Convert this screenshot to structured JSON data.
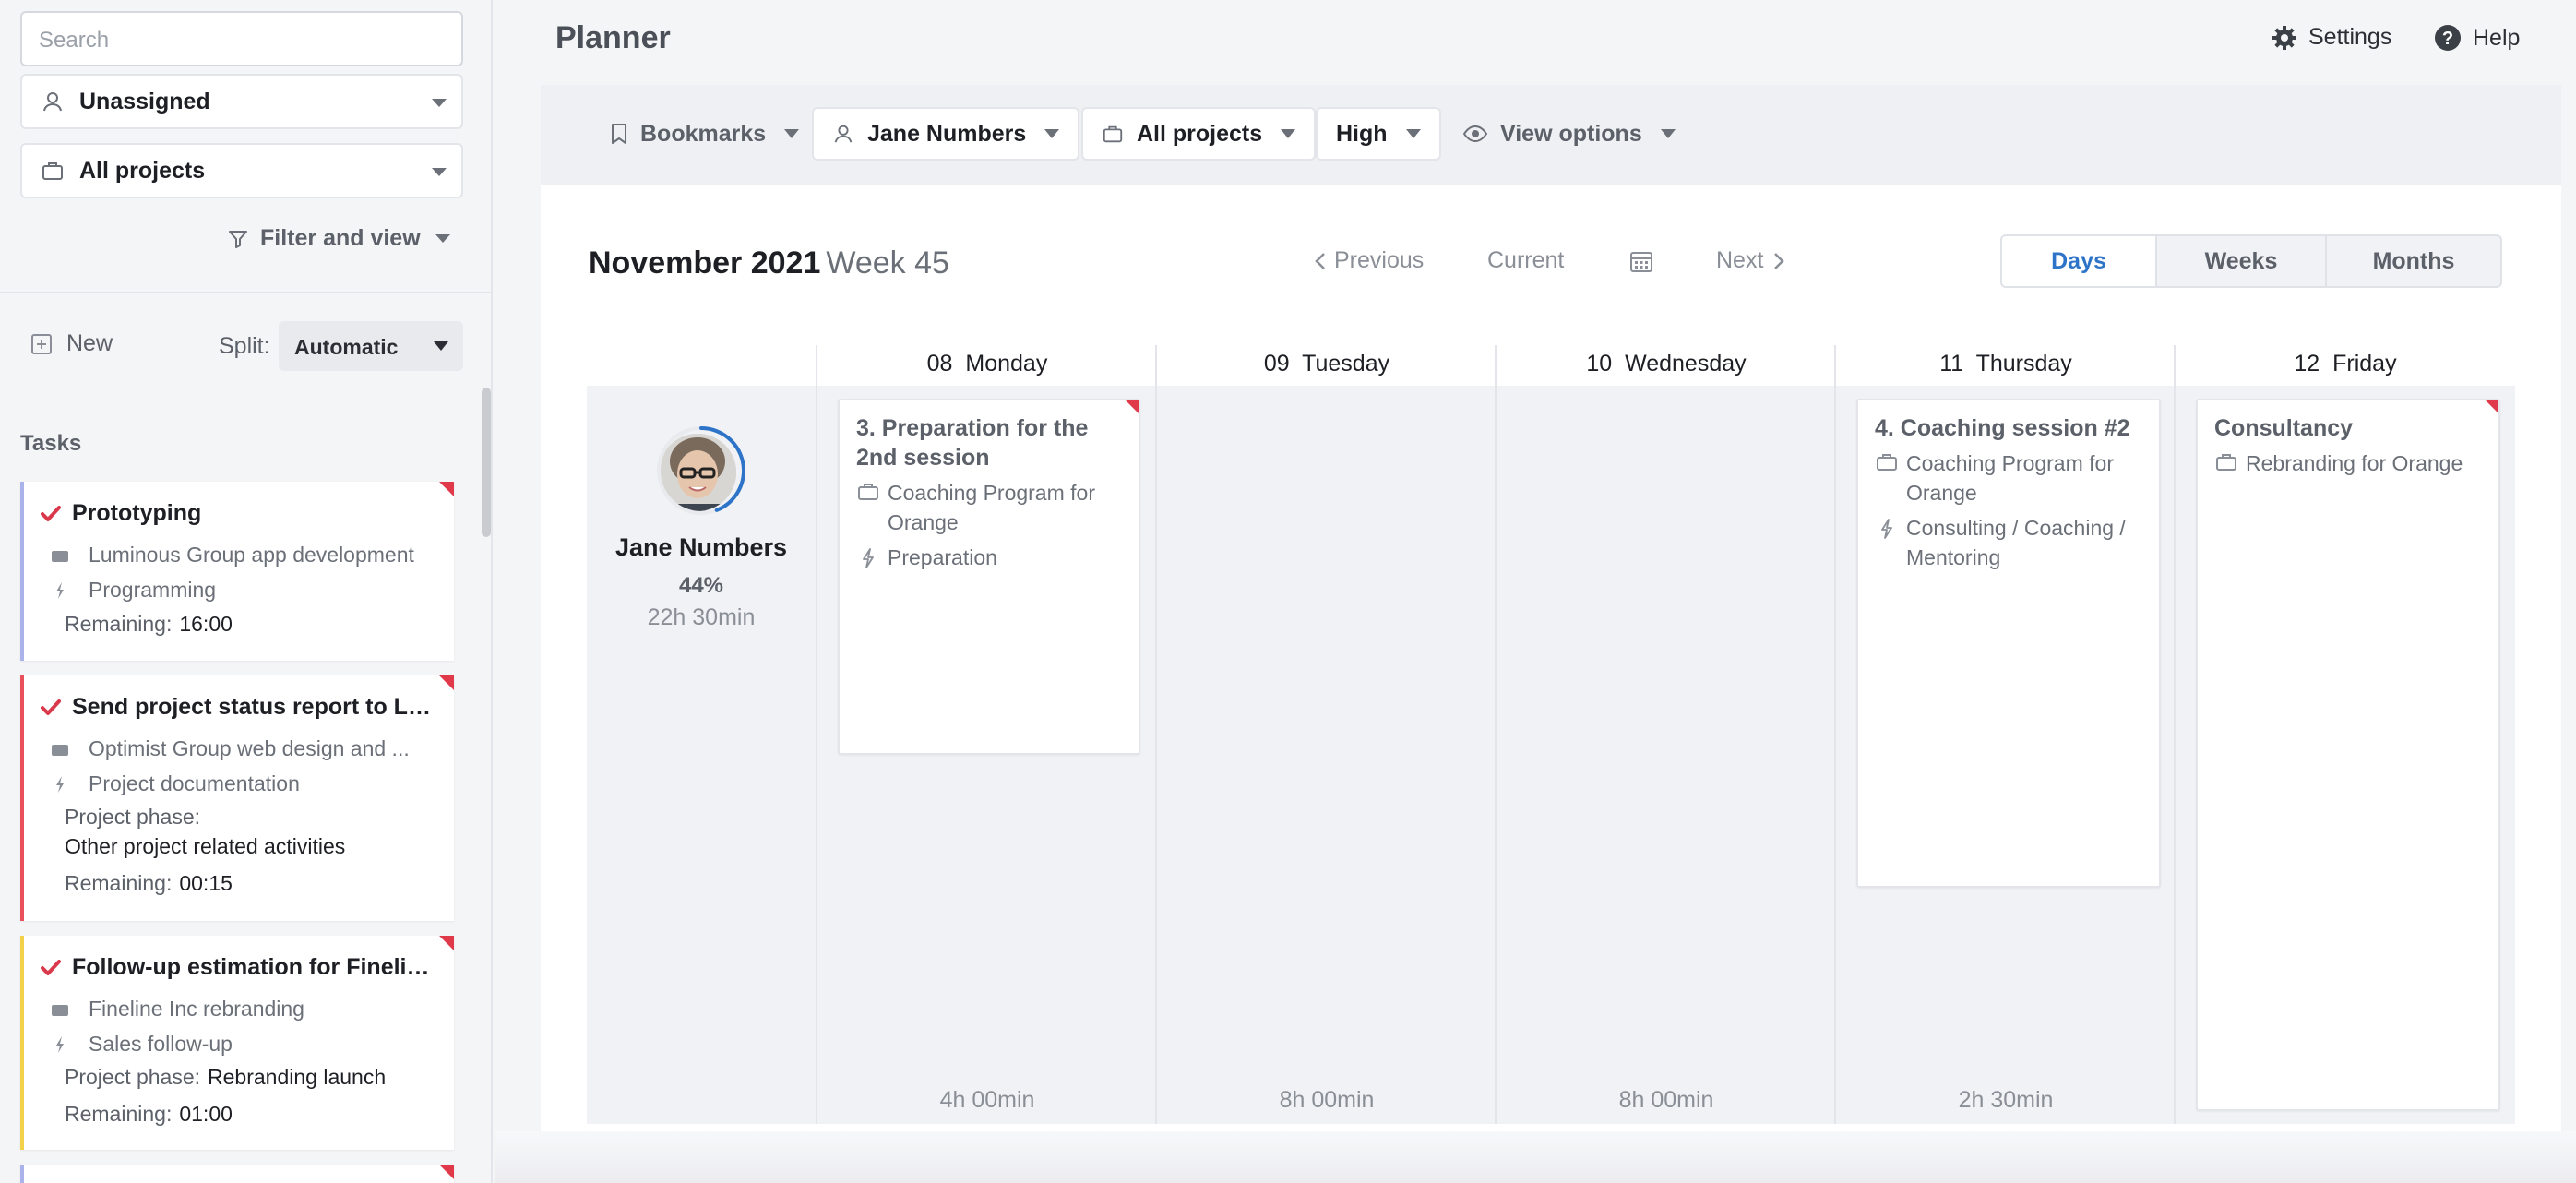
{
  "sidebar": {
    "search_placeholder": "Search",
    "user_select": "Unassigned",
    "project_select": "All projects",
    "filter_label": "Filter and view",
    "new_label": "New",
    "split_label": "Split:",
    "split_value": "Automatic",
    "tasks_heading": "Tasks",
    "tasks": [
      {
        "title": "Prototyping",
        "project": "Luminous Group app development",
        "activity": "Programming",
        "remaining_label": "Remaining:",
        "remaining": "16:00",
        "color": "#aab4ea"
      },
      {
        "title": "Send project status report to Lia...",
        "project": "Optimist Group web design and ...",
        "activity": "Project documentation",
        "phase_label": "Project phase:",
        "phase": "Other project related activities",
        "remaining_label": "Remaining:",
        "remaining": "00:15",
        "color": "#e8505b"
      },
      {
        "title": "Follow-up estimation for Finelin...",
        "project": "Fineline Inc rebranding",
        "activity": "Sales follow-up",
        "phase_label": "Project phase:",
        "phase": "Rebranding launch",
        "remaining_label": "Remaining:",
        "remaining": "01:00",
        "color": "#f2d24a"
      }
    ]
  },
  "header": {
    "title": "Planner",
    "settings_label": "Settings",
    "help_label": "Help"
  },
  "toolbar": {
    "bookmarks": "Bookmarks",
    "person": "Jane Numbers",
    "projects": "All projects",
    "priority": "High",
    "view_options": "View options"
  },
  "planner": {
    "month": "November 2021",
    "week": "Week 45",
    "prev": "Previous",
    "current": "Current",
    "next": "Next",
    "views": [
      "Days",
      "Weeks",
      "Months"
    ],
    "active_view": "Days",
    "days": [
      {
        "num": "08",
        "name": "Monday",
        "hours": "4h 00min"
      },
      {
        "num": "09",
        "name": "Tuesday",
        "hours": "8h 00min"
      },
      {
        "num": "10",
        "name": "Wednesday",
        "hours": "8h 00min"
      },
      {
        "num": "11",
        "name": "Thursday",
        "hours": "2h 30min"
      },
      {
        "num": "12",
        "name": "Friday",
        "hours": ""
      }
    ],
    "person": {
      "name": "Jane Numbers",
      "percent": "44%",
      "percent_value": 0.44,
      "hours": "22h 30min"
    },
    "cards": [
      {
        "title": "3. Preparation for the 2nd session",
        "project": "Coaching Program for Orange",
        "activity": "Preparation"
      },
      {
        "title": "4. Coaching session #2",
        "project": "Coaching Program for Orange",
        "activity": "Consulting / Coaching / Mentoring"
      },
      {
        "title": "Consultancy",
        "project": "Rebranding for Orange"
      }
    ]
  },
  "colors": {
    "accent": "#2d74c8",
    "priority_flag": "#e03a4a",
    "check": "#d9394a"
  }
}
